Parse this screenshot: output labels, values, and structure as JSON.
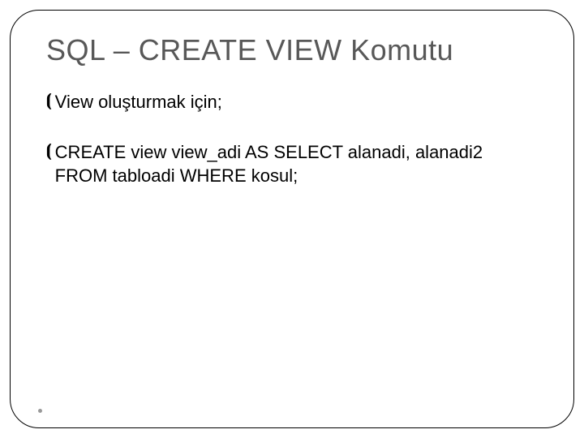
{
  "title": "SQL – CREATE VIEW Komutu",
  "bullets": [
    {
      "text": "View oluşturmak için;"
    },
    {
      "text": "CREATE view view_adi AS SELECT alanadi, alanadi2 FROM tabloadi WHERE kosul;"
    }
  ]
}
